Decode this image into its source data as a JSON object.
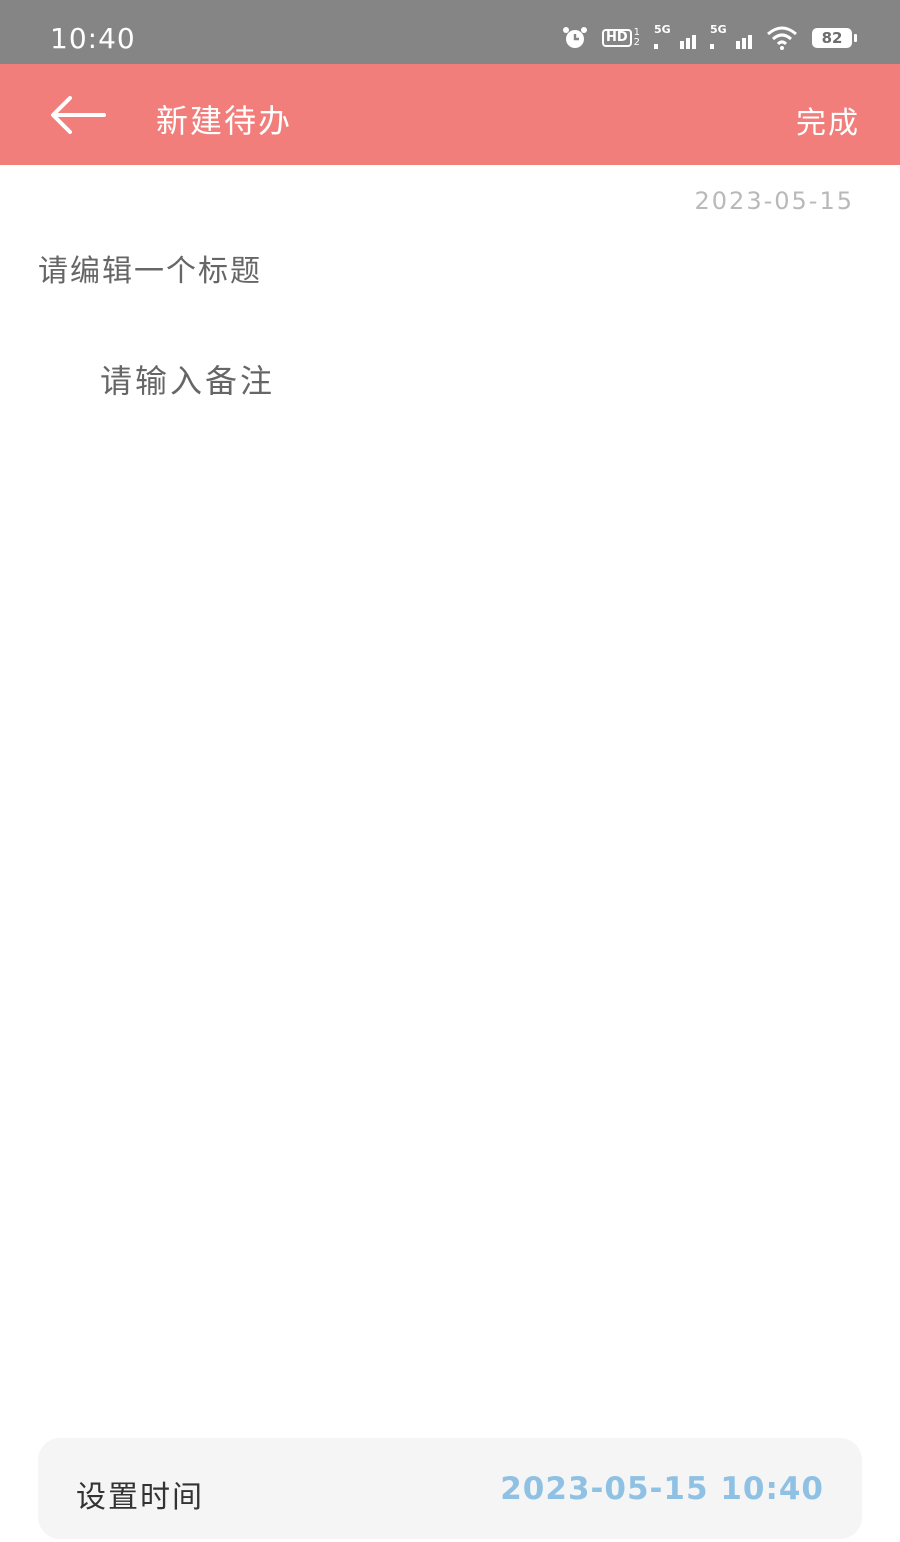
{
  "status_bar": {
    "time": "10:40",
    "icons": [
      "alarm-icon",
      "hd-icon",
      "signal-5g-icon",
      "signal-5g-icon",
      "wifi-icon",
      "battery-icon"
    ],
    "hd_label": "HD",
    "hd_sub": [
      "1",
      "2"
    ],
    "network_label": "5G",
    "battery_level": "82"
  },
  "app_bar": {
    "back_icon": "arrow-left-icon",
    "title": "新建待办",
    "done_label": "完成",
    "color": "#f27e7b"
  },
  "editor": {
    "date": "2023-05-15",
    "title_placeholder": "请编辑一个标题",
    "title_value": "",
    "note_placeholder": "请输入备注",
    "note_value": ""
  },
  "time_setting": {
    "label": "设置时间",
    "value": "2023-05-15 10:40",
    "value_color": "#8ec1e3"
  }
}
